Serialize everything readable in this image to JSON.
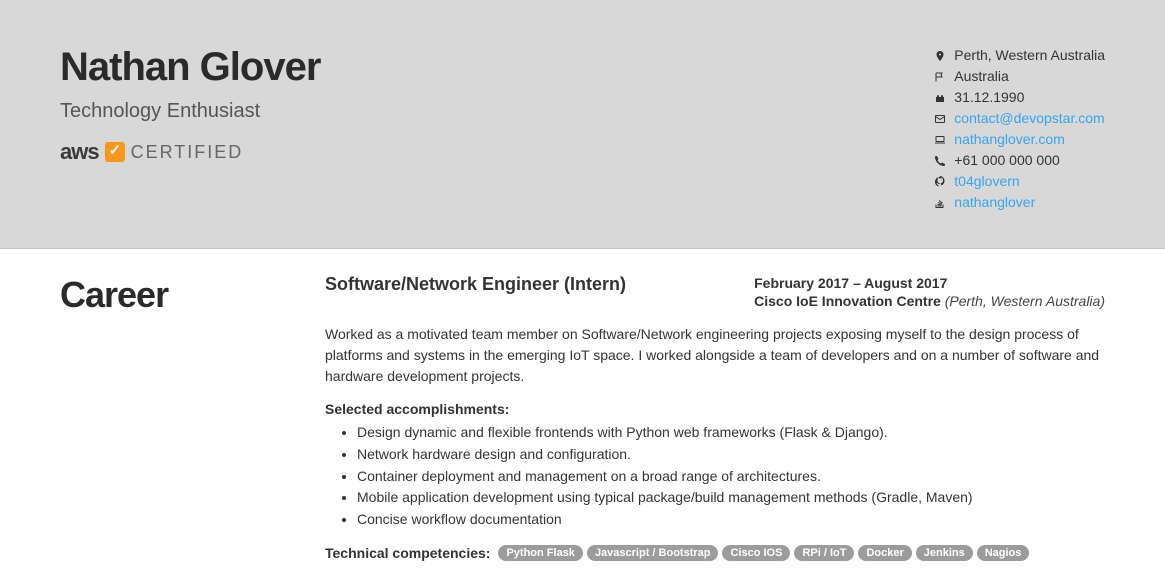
{
  "header": {
    "name": "Nathan Glover",
    "subtitle": "Technology Enthusiast",
    "cert_brand": "aws",
    "cert_text": "CERTIFIED"
  },
  "contact": {
    "location": "Perth, Western Australia",
    "country": "Australia",
    "birthdate": "31.12.1990",
    "email": "contact@devopstar.com",
    "website": "nathanglover.com",
    "phone": "+61 000 000 000",
    "github": "t04glovern",
    "stack": "nathanglover"
  },
  "career": {
    "section_title": "Career",
    "job": {
      "title": "Software/Network Engineer (Intern)",
      "dates": "February 2017 – August 2017",
      "company": "Cisco IoE Innovation Centre",
      "location": "(Perth, Western Australia)",
      "description": "Worked as a motivated team member on Software/Network engineering projects exposing myself to the design process of platforms and systems in the emerging IoT space. I worked alongside a team of developers and on a number of software and hardware development projects.",
      "accomp_title": "Selected accomplishments:",
      "accomplishments": [
        "Design dynamic and flexible frontends with Python web frameworks (Flask & Django).",
        "Network hardware design and configuration.",
        "Container deployment and management on a broad range of architectures.",
        "Mobile application development using typical package/build management methods (Gradle, Maven)",
        "Concise workflow documentation"
      ],
      "tech_label": "Technical competencies:",
      "tech_pills": [
        "Python Flask",
        "Javascript / Bootstrap",
        "Cisco IOS",
        "RPi / IoT",
        "Docker",
        "Jenkins",
        "Nagios"
      ]
    }
  }
}
